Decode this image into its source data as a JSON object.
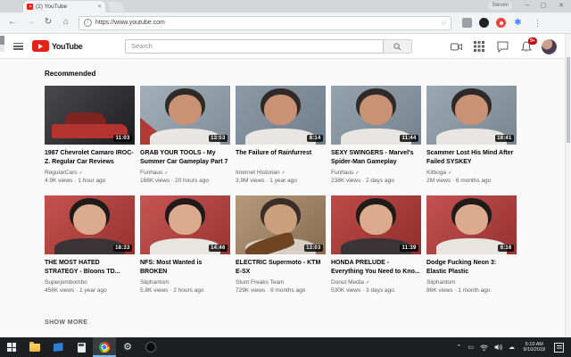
{
  "browser": {
    "tab_title": "(2) YouTube",
    "profile_name": "Steven",
    "url": "https://www.youtube.com",
    "minimize_label": "─",
    "maximize_label": "▢",
    "close_label": "✕",
    "tab_close_label": "✕",
    "back_label": "←",
    "forward_label": "→",
    "reload_label": "↻",
    "home_label": "⌂",
    "star_label": "☆",
    "menu_label": "⋮",
    "ext4_glyph": "✱",
    "info_glyph": "i"
  },
  "youtube_header": {
    "logo_text": "YouTube",
    "search_placeholder": "Search",
    "notification_badge": "9+"
  },
  "page": {
    "section_title": "Recommended",
    "show_more_label": "SHOW MORE"
  },
  "videos": [
    {
      "title": "1987 Chevrolet Camaro IROC-Z. Regular Car Reviews",
      "channel": "RegularCars",
      "verified": true,
      "meta": "4.9K views · 1 hour ago",
      "duration": "11:03",
      "thumb": {
        "variant": "car",
        "bg1": "#4a4a4e",
        "bg2": "#1e1e22",
        "accent": "#b3342e"
      }
    },
    {
      "title": "GRAB YOUR TOOLS - My Summer Car Gameplay Part 7",
      "channel": "Funhaus",
      "verified": true,
      "meta": "166K views · 20 hours ago",
      "duration": "13:53",
      "thumb": {
        "variant": "face",
        "bg1": "#a3b0ba",
        "bg2": "#7e8d99",
        "skin": "#c99274",
        "hair": "#2f2a28",
        "shirt": "#e8e6e2",
        "accent": "#b23a35"
      }
    },
    {
      "title": "The Failure of Rainfurrest",
      "channel": "Internet Historian",
      "verified": true,
      "meta": "3.9M views · 1 year ago",
      "duration": "8:14",
      "thumb": {
        "variant": "face",
        "bg1": "#8c9aa6",
        "bg2": "#6f7e8a",
        "skin": "#c99274",
        "hair": "#2f2a28",
        "shirt": "#e8e6e2"
      }
    },
    {
      "title": "SEXY SWINGERS - Marvel's Spider-Man Gameplay",
      "channel": "Funhaus",
      "verified": true,
      "meta": "238K views · 2 days ago",
      "duration": "11:44",
      "thumb": {
        "variant": "face",
        "bg1": "#95a3ae",
        "bg2": "#75848f",
        "skin": "#c99274",
        "hair": "#2f2a28",
        "shirt": "#e8e6e2"
      }
    },
    {
      "title": "Scammer Lost His Mind After Failed SYSKEY",
      "channel": "Kitboga",
      "verified": true,
      "meta": "2M views · 6 months ago",
      "duration": "18:41",
      "thumb": {
        "variant": "face",
        "bg1": "#9aa8b2",
        "bg2": "#788791",
        "skin": "#c99274",
        "hair": "#2f2a28",
        "shirt": "#e8e6e2"
      }
    },
    {
      "title": "THE MOST HATED STRATEGY - Bloons TD...",
      "channel": "Superjombombo",
      "verified": false,
      "meta": "456K views · 1 year ago",
      "duration": "18:33",
      "thumb": {
        "variant": "face",
        "bg1": "#c4524f",
        "bg2": "#96322f",
        "skin": "#dcab8e",
        "hair": "#1f1b1a",
        "shirt": "#3a3436"
      }
    },
    {
      "title": "NFS: Most Wanted is BROKEN",
      "channel": "Sliphantom",
      "verified": false,
      "meta": "5.8K views · 2 hours ago",
      "duration": "14:46",
      "thumb": {
        "variant": "face",
        "bg1": "#c65553",
        "bg2": "#9a3533",
        "skin": "#dcab8e",
        "hair": "#1f1b1a",
        "shirt": "#e8e4df"
      }
    },
    {
      "title": "ELECTRIC Supermoto - KTM E-SX",
      "channel": "Stunt Freaks Team",
      "verified": false,
      "meta": "729K views · 9 months ago",
      "duration": "13:03",
      "thumb": {
        "variant": "guitar",
        "bg1": "#b59a7d",
        "bg2": "#876c52",
        "skin": "#caa07f",
        "hair": "#3a2e26",
        "shirt": "#d8cfc4"
      }
    },
    {
      "title": "HONDA PRELUDE - Everything You Need to Kno...",
      "channel": "Donut Media",
      "verified": true,
      "meta": "530K views · 3 days ago",
      "duration": "11:39",
      "thumb": {
        "variant": "face",
        "bg1": "#bd4a47",
        "bg2": "#8f2f2d",
        "skin": "#dcab8e",
        "hair": "#1f1b1a",
        "shirt": "#3a3436"
      }
    },
    {
      "title": "Dodge Fucking Neon 3: Elastic Plastic",
      "channel": "Sliphantom",
      "verified": false,
      "meta": "86K views · 1 month ago",
      "duration": "6:16",
      "thumb": {
        "variant": "face",
        "bg1": "#c35150",
        "bg2": "#953332",
        "skin": "#dcab8e",
        "hair": "#1f1b1a",
        "shirt": "#e8e4df"
      }
    }
  ],
  "taskbar": {
    "time": "5:10 AM",
    "date": "9/10/2018",
    "chevron": "⌃",
    "tray_window": "▭",
    "wifi": "◠",
    "volume": "◁)",
    "cloud": "☁"
  },
  "colors": {
    "youtube_red": "#e62117",
    "badge_red": "#cc0000",
    "taskbar_bg": "#1d1f21",
    "active_underline": "#76b9ed"
  }
}
